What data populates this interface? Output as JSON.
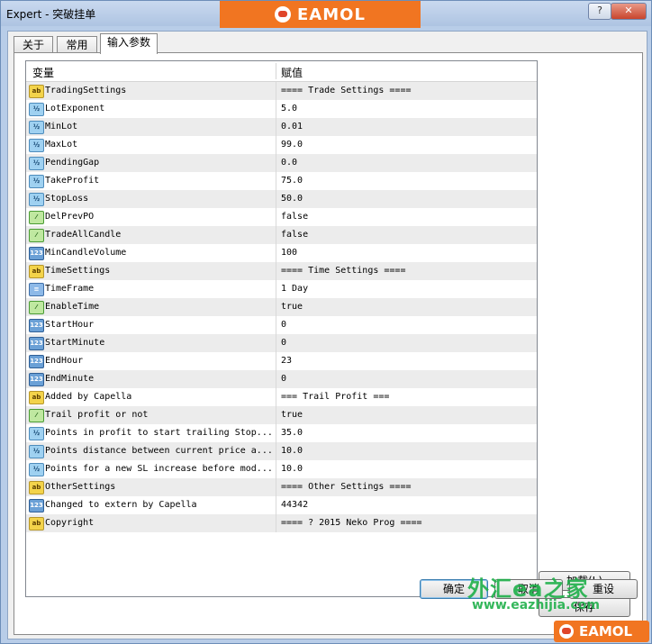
{
  "window": {
    "title": "Expert - 突破挂单",
    "help_label": "?",
    "close_label": "✕"
  },
  "brand": {
    "name": "EAMOL",
    "icon": "eamol-robot-logo"
  },
  "tabs": [
    {
      "label": "关于"
    },
    {
      "label": "常用"
    },
    {
      "label": "输入参数",
      "active": true
    }
  ],
  "grid": {
    "headers": {
      "variable": "变量",
      "value": "赋值"
    },
    "rows": [
      {
        "type": "string",
        "icon": "ab",
        "name": "TradingSettings",
        "value": "==== Trade Settings ===="
      },
      {
        "type": "double",
        "icon": "½",
        "name": "LotExponent",
        "value": "5.0"
      },
      {
        "type": "double",
        "icon": "½",
        "name": "MinLot",
        "value": "0.01"
      },
      {
        "type": "double",
        "icon": "½",
        "name": "MaxLot",
        "value": "99.0"
      },
      {
        "type": "double",
        "icon": "½",
        "name": "PendingGap",
        "value": "0.0"
      },
      {
        "type": "double",
        "icon": "½",
        "name": "TakeProfit",
        "value": "75.0"
      },
      {
        "type": "double",
        "icon": "½",
        "name": "StopLoss",
        "value": "50.0"
      },
      {
        "type": "bool",
        "icon": "⁄",
        "name": "DelPrevPO",
        "value": "false"
      },
      {
        "type": "bool",
        "icon": "⁄",
        "name": "TradeAllCandle",
        "value": "false"
      },
      {
        "type": "int",
        "icon": "123",
        "name": "MinCandleVolume",
        "value": "100"
      },
      {
        "type": "string",
        "icon": "ab",
        "name": "TimeSettings",
        "value": "==== Time Settings ===="
      },
      {
        "type": "enum",
        "icon": "≡",
        "name": "TimeFrame",
        "value": "1 Day"
      },
      {
        "type": "bool",
        "icon": "⁄",
        "name": "EnableTime",
        "value": "true"
      },
      {
        "type": "int",
        "icon": "123",
        "name": "StartHour",
        "value": "0"
      },
      {
        "type": "int",
        "icon": "123",
        "name": "StartMinute",
        "value": "0"
      },
      {
        "type": "int",
        "icon": "123",
        "name": "EndHour",
        "value": "23"
      },
      {
        "type": "int",
        "icon": "123",
        "name": "EndMinute",
        "value": "0"
      },
      {
        "type": "string",
        "icon": "ab",
        "name": "Added by Capella",
        "value": "=== Trail Profit ==="
      },
      {
        "type": "bool",
        "icon": "⁄",
        "name": "Trail profit or not",
        "value": "true"
      },
      {
        "type": "double",
        "icon": "½",
        "name": "Points in profit to start trailing Stop...",
        "value": "35.0"
      },
      {
        "type": "double",
        "icon": "½",
        "name": "Points distance between current price a...",
        "value": "10.0"
      },
      {
        "type": "double",
        "icon": "½",
        "name": "Points for a new SL increase before mod...",
        "value": "10.0"
      },
      {
        "type": "string",
        "icon": "ab",
        "name": "OtherSettings",
        "value": "==== Other Settings ===="
      },
      {
        "type": "int",
        "icon": "123",
        "name": "Changed to extern by Capella",
        "value": "44342"
      },
      {
        "type": "string",
        "icon": "ab",
        "name": "Copyright",
        "value": "==== ? 2015 Neko Prog ===="
      }
    ]
  },
  "buttons": {
    "load": "加载(L)",
    "save": "保存",
    "ok": "确定",
    "cancel": "取消",
    "reset": "重设"
  },
  "watermark": {
    "cn": "外汇ea之家",
    "url": "www.eazhijia.com",
    "badge": "EAMOL"
  }
}
